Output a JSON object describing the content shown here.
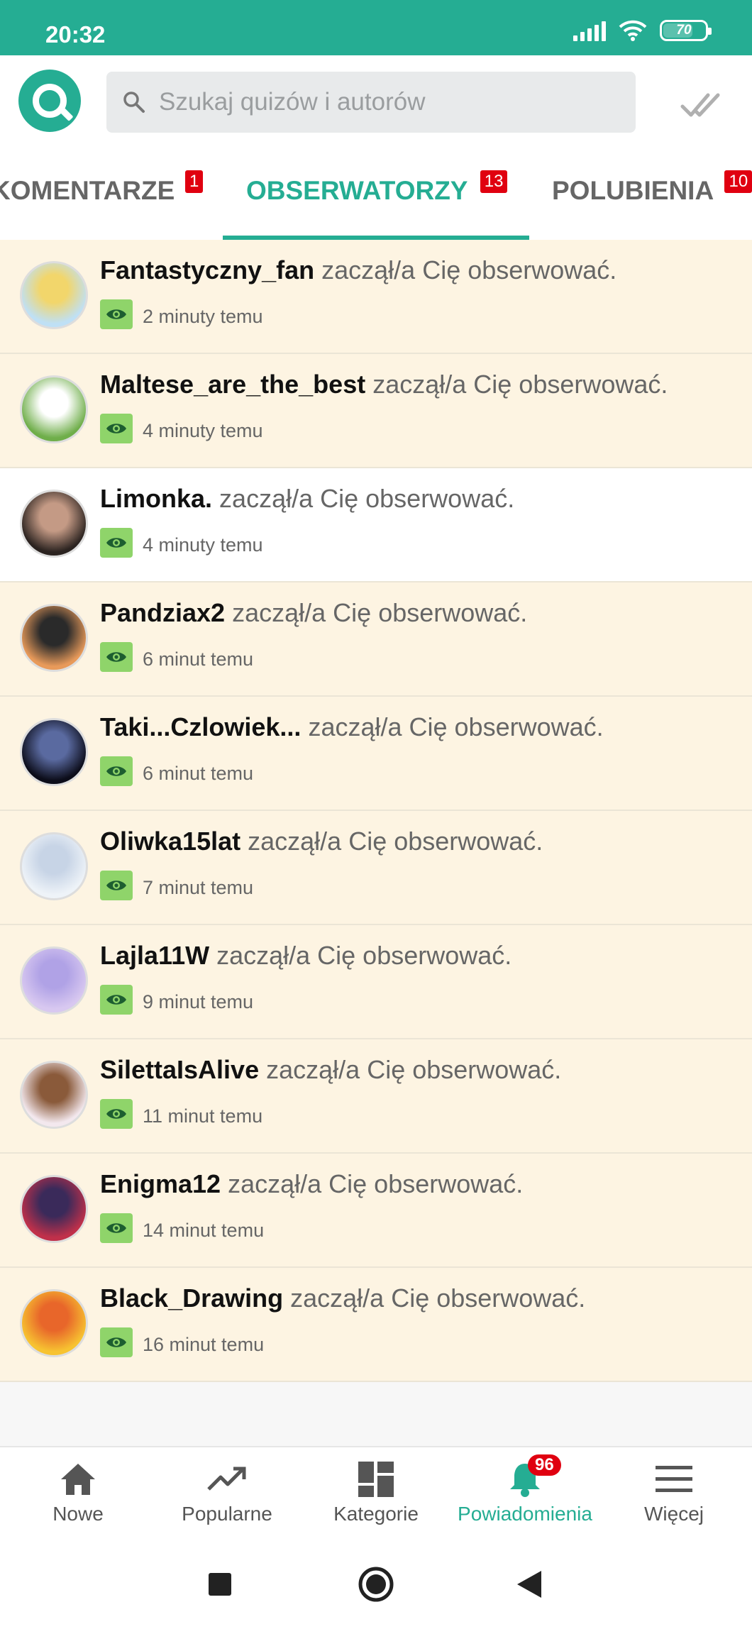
{
  "status_bar": {
    "time": "20:32",
    "battery": "70",
    "battery_level": 0.7
  },
  "header": {
    "search_placeholder": "Szukaj quizów i autorów"
  },
  "tabs": [
    {
      "label": "KOMENTARZE",
      "badge": "1"
    },
    {
      "label": "OBSERWATORZY",
      "badge": "13"
    },
    {
      "label": "POLUBIENIA",
      "badge": "10"
    }
  ],
  "notifications": [
    {
      "user": "Fantastyczny_fan",
      "action": "zaczął/a Cię obserwować.",
      "time": "2 minuty temu",
      "avatar_colors": [
        "#bfe0f5",
        "#f2d66b"
      ]
    },
    {
      "user": "Maltese_are_the_best",
      "action": "zaczął/a Cię obserwować.",
      "time": "4 minuty temu",
      "avatar_colors": [
        "#6fae4a",
        "#ffffff"
      ]
    },
    {
      "user": "Limonka.",
      "action": "zaczął/a Cię obserwować.",
      "time": "4 minuty temu",
      "avatar_colors": [
        "#2b2320",
        "#c49a85"
      ]
    },
    {
      "user": "Pandziax2",
      "action": "zaczął/a Cię obserwować.",
      "time": "6 minut temu",
      "avatar_colors": [
        "#e89a5a",
        "#2a2a2a"
      ]
    },
    {
      "user": "Taki...Czlowiek...",
      "action": "zaczął/a Cię obserwować.",
      "time": "6 minut temu",
      "avatar_colors": [
        "#0c0d1a",
        "#5a6aa0"
      ]
    },
    {
      "user": "Oliwka15lat",
      "action": "zaczął/a Cię obserwować.",
      "time": "7 minut temu",
      "avatar_colors": [
        "#eef3f8",
        "#c7d4e6"
      ]
    },
    {
      "user": "Lajla11W",
      "action": "zaczął/a Cię obserwować.",
      "time": "9 minut temu",
      "avatar_colors": [
        "#d8c8f0",
        "#b0a2e6"
      ]
    },
    {
      "user": "SilettaIsAlive",
      "action": "zaczął/a Cię obserwować.",
      "time": "11 minut temu",
      "avatar_colors": [
        "#f3e8ee",
        "#8a5a3a"
      ]
    },
    {
      "user": "Enigma12",
      "action": "zaczął/a Cię obserwować.",
      "time": "14 minut temu",
      "avatar_colors": [
        "#c0304a",
        "#3a2a5a"
      ]
    },
    {
      "user": "Black_Drawing",
      "action": "zaczął/a Cię obserwować.",
      "time": "16 minut temu",
      "avatar_colors": [
        "#f7c331",
        "#e8662a"
      ]
    }
  ],
  "bottom_nav": [
    {
      "label": "Nowe",
      "icon": "home-icon"
    },
    {
      "label": "Popularne",
      "icon": "trending-icon"
    },
    {
      "label": "Kategorie",
      "icon": "grid-icon"
    },
    {
      "label": "Powiadomienia",
      "icon": "bell-icon",
      "badge": "96"
    },
    {
      "label": "Więcej",
      "icon": "menu-icon"
    }
  ],
  "colors": {
    "accent": "#25ad93",
    "unread_bg": "#fdf4e2",
    "badge": "#e00010",
    "eye_badge": "#8fd46a"
  }
}
